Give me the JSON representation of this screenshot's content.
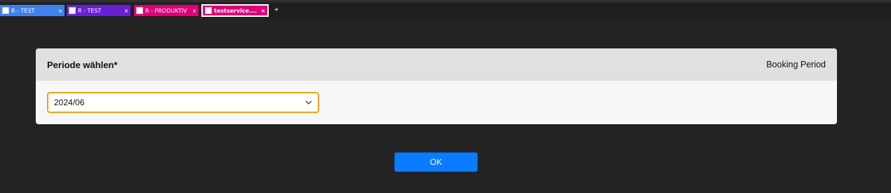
{
  "browser": {
    "tabs": [
      {
        "title": "R - TEST",
        "close": "×",
        "color": "#3c82f0"
      },
      {
        "title": "R - TEST",
        "close": "×",
        "color": "#6a1fd6"
      },
      {
        "title": "R - PRODUKTIV",
        "close": "×",
        "color": "#e0007a"
      },
      {
        "title": "testservice.ra...",
        "close": "×",
        "color": "#e0007a",
        "active": true
      }
    ],
    "new_tab": "+"
  },
  "dialog": {
    "title": "Periode wählen*",
    "context": "Booking Period",
    "select": {
      "value": "2024/06",
      "chevron_icon": "chevron-down-icon"
    },
    "ok_label": "OK"
  },
  "colors": {
    "background": "#232323",
    "accent": "#0b7bff",
    "focus_border": "#f0a11a"
  }
}
